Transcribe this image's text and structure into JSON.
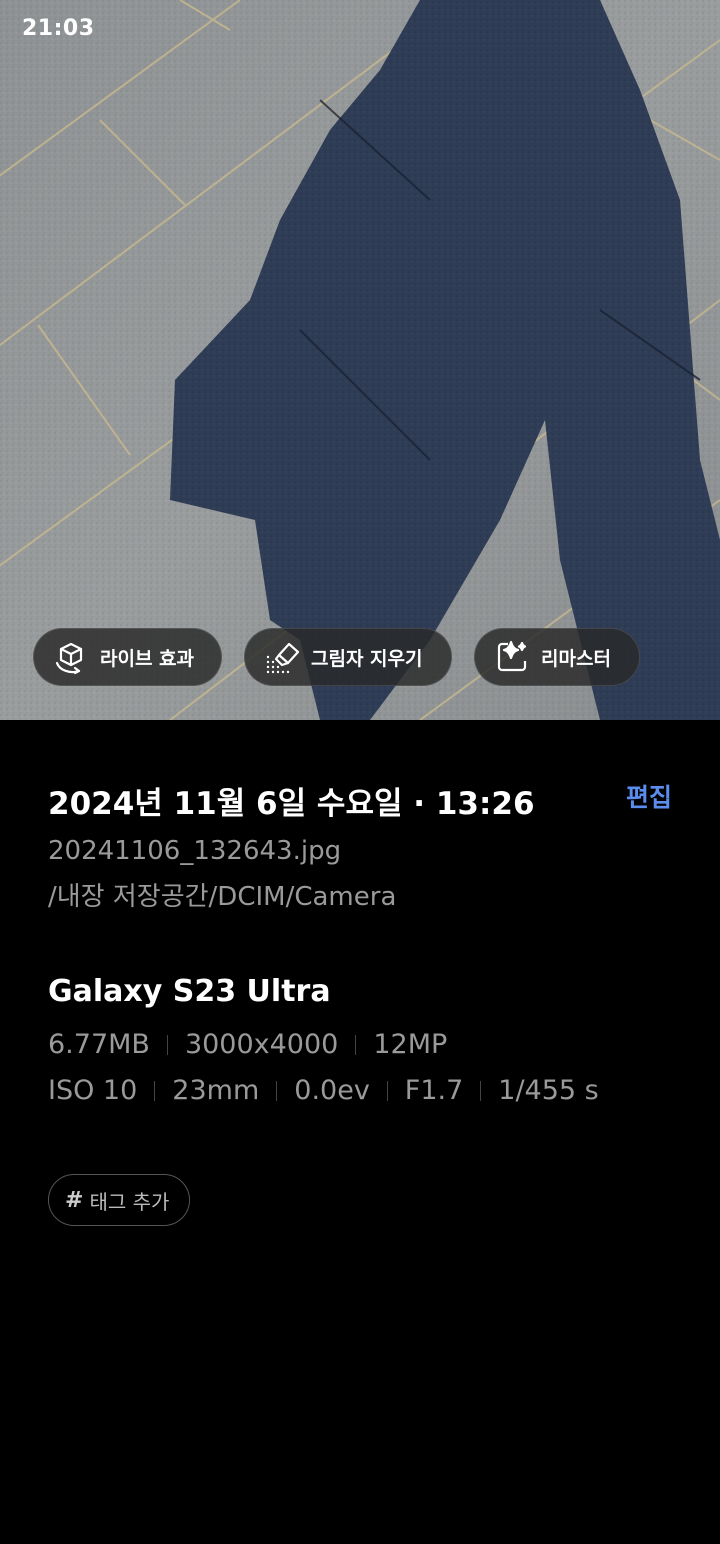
{
  "status_bar": {
    "time": "21:03"
  },
  "photo": {
    "actions": [
      {
        "label": "라이브 효과",
        "icon": "live-effect-icon"
      },
      {
        "label": "그림자 지우기",
        "icon": "shadow-eraser-icon"
      },
      {
        "label": "리마스터",
        "icon": "remaster-icon"
      }
    ]
  },
  "details": {
    "date_title": "2024년 11월 6일 수요일 · 13:26",
    "edit_label": "편집",
    "filename": "20241106_132643.jpg",
    "path": "/내장 저장공간/DCIM/Camera",
    "device_model": "Galaxy S23 Ultra",
    "specs_row1": [
      "6.77MB",
      "3000x4000",
      "12MP"
    ],
    "specs_row2": [
      "ISO 10",
      "23mm",
      "0.0ev",
      "F1.7",
      "1/455 s"
    ],
    "tag_add_label": "태그 추가"
  },
  "colors": {
    "accent": "#5b8def",
    "background": "#000000",
    "secondary_text": "#9a9a9a"
  }
}
